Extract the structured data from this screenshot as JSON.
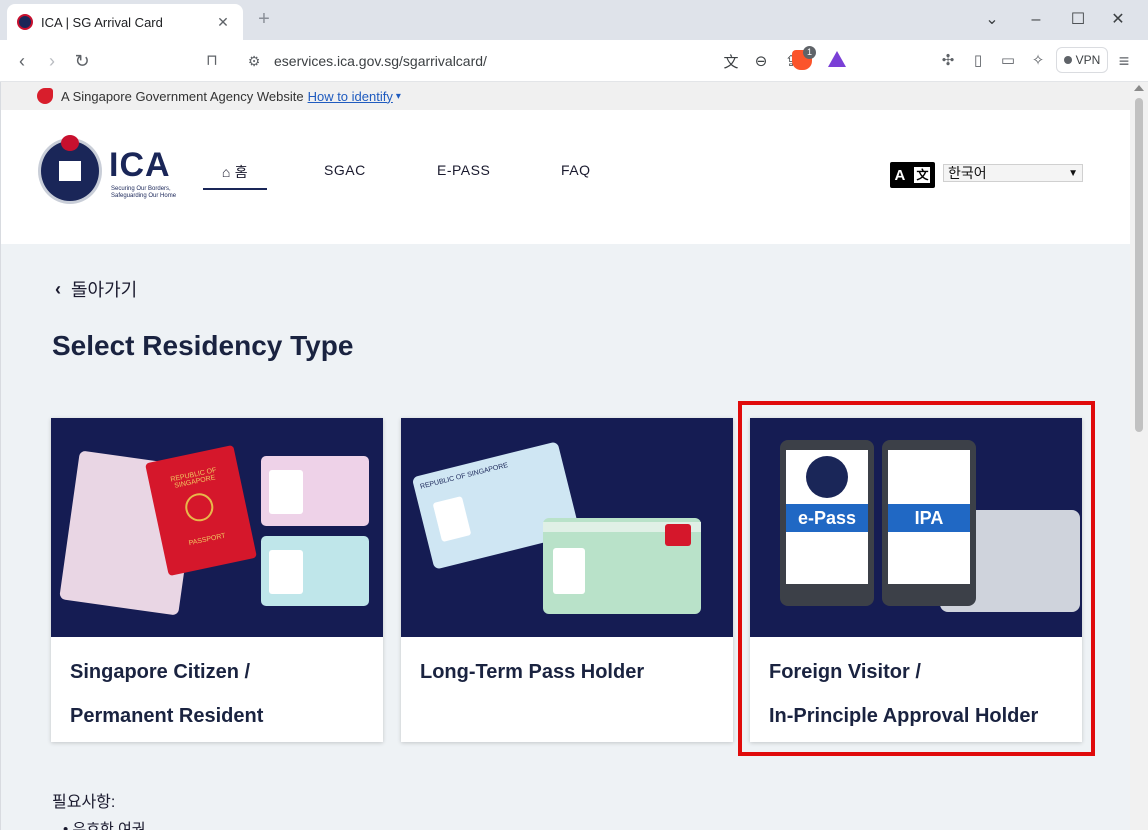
{
  "browser": {
    "tab_title": "ICA | SG Arrival Card",
    "tab_close": "✕",
    "new_tab": "+",
    "url": "eservices.ica.gov.sg/sgarrivalcard/",
    "brave_badge": "1",
    "vpn_label": "VPN"
  },
  "gov_banner": {
    "text": "A Singapore Government Agency Website",
    "link": "How to identify"
  },
  "header": {
    "logo_text": "ICA",
    "logo_tagline": "Securing Our Borders, Safeguarding Our Home",
    "nav": {
      "home": "홈",
      "sgac": "SGAC",
      "epass": "E-PASS",
      "faq": "FAQ"
    },
    "language_icon_a": "A",
    "language_icon_zh": "文",
    "language_selected": "한국어"
  },
  "main": {
    "back_label": "돌아가기",
    "title": "Select Residency Type",
    "cards": [
      {
        "line1": "Singapore Citizen /",
        "line2": "Permanent Resident"
      },
      {
        "line1": "Long-Term Pass Holder",
        "line2": ""
      },
      {
        "line1": "Foreign Visitor /",
        "line2": "In-Principle Approval Holder"
      }
    ],
    "card_art": {
      "passport_text": "REPUBLIC OF SINGAPORE",
      "passport_label": "PASSPORT",
      "ltp_text": "REPUBLIC OF SINGAPORE",
      "epass_label": "e-Pass",
      "ipa_label": "IPA"
    },
    "requirements_label": "필요사항:",
    "requirements_first": "유효한 여권"
  }
}
